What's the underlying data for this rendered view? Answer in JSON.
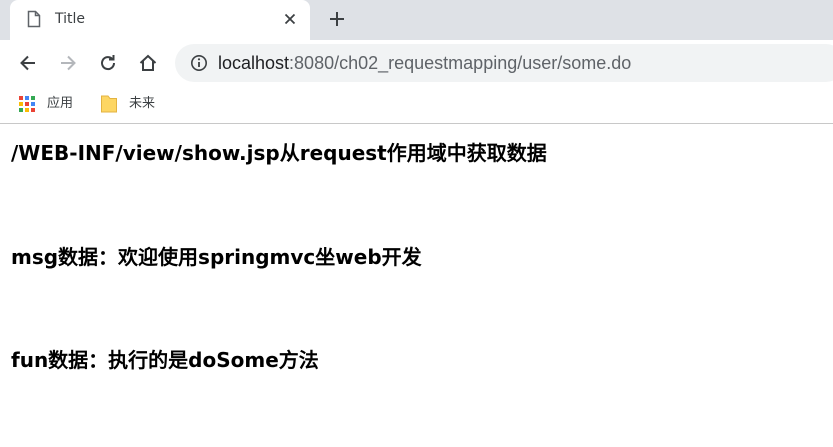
{
  "tab": {
    "title": "Title"
  },
  "address_bar": {
    "host": "localhost",
    "path": ":8080/ch02_requestmapping/user/some.do"
  },
  "bookmarks": [
    {
      "label": "应用",
      "icon": "apps-grid-icon"
    },
    {
      "label": "未来",
      "icon": "folder-icon"
    }
  ],
  "content": {
    "heading": "/WEB-INF/view/show.jsp从request作用域中获取数据",
    "msg": "msg数据：欢迎使用springmvc坐web开发",
    "fun": "fun数据：执行的是doSome方法"
  },
  "colors": {
    "tabstrip": "#dee1e6",
    "omnibox": "#f1f3f4",
    "text": "#000000"
  }
}
